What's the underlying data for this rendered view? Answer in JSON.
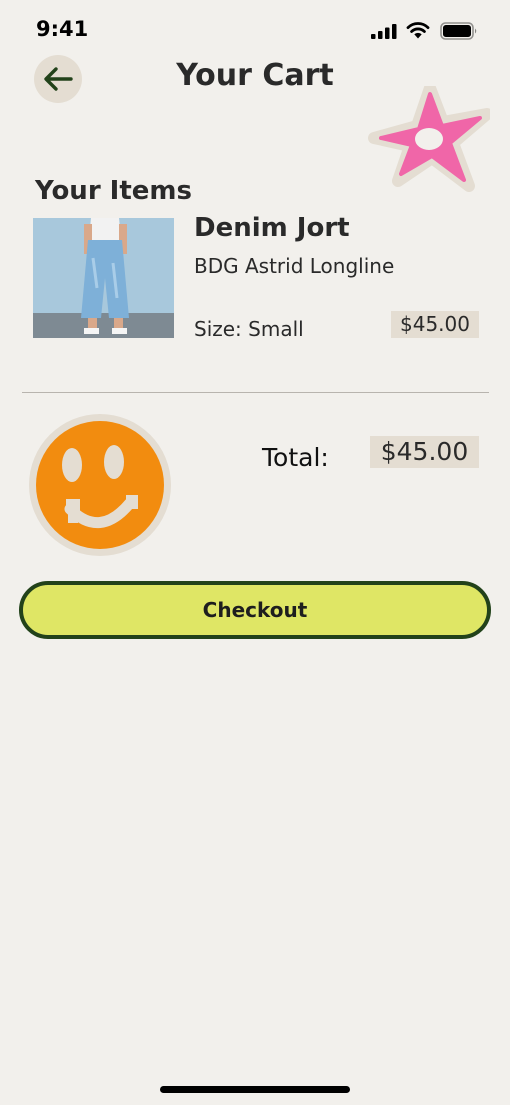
{
  "status": {
    "time": "9:41"
  },
  "header": {
    "title": "Your Cart"
  },
  "items_section": {
    "title": "Your Items"
  },
  "item": {
    "name": "Denim Jort",
    "subtitle": "BDG Astrid Longline",
    "size": "Size: Small",
    "price": "$45.00"
  },
  "summary": {
    "total_label": "Total:",
    "total_price": "$45.00"
  },
  "checkout": {
    "label": "Checkout"
  },
  "icons": {
    "back": "arrow-left-icon",
    "status": [
      "cellular-signal-icon",
      "wifi-icon",
      "battery-icon"
    ],
    "stickers": [
      "flower-sticker",
      "smiley-face-sticker"
    ]
  },
  "colors": {
    "background": "#f2f0ec",
    "accent_beige": "#e4ddd2",
    "checkout_fill": "#dfe665",
    "checkout_border": "#22421a",
    "flower_pink": "#f066a8",
    "smiley_orange": "#f28c0f"
  }
}
